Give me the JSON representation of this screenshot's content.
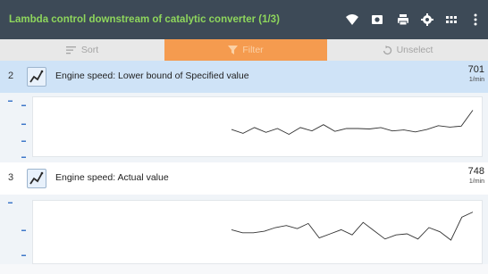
{
  "header": {
    "title": "Lambda control downstream of catalytic converter (1/3)",
    "icons": [
      "wifi-icon",
      "camera-icon",
      "print-icon",
      "settings-icon",
      "grid-icon",
      "more-icon"
    ]
  },
  "toolbar": {
    "sort_label": "Sort",
    "filter_label": "Filter",
    "unselect_label": "Unselect"
  },
  "colors": {
    "header_bg": "#3d4a57",
    "title_text": "#8ed65c",
    "filter_active": "#f59b4f",
    "selected_row": "#cfe3f7"
  },
  "rows": [
    {
      "index": "2",
      "label": "Engine speed: Lower bound of Specified value",
      "value": "701",
      "unit": "1/min",
      "selected": true,
      "icon": "graph-icon",
      "trend": [
        0.48,
        0.4,
        0.52,
        0.42,
        0.5,
        0.38,
        0.52,
        0.45,
        0.58,
        0.44,
        0.5,
        0.5,
        0.49,
        0.52,
        0.45,
        0.47,
        0.43,
        0.48,
        0.56,
        0.53,
        0.55,
        0.88
      ]
    },
    {
      "index": "3",
      "label": "Engine speed: Actual value",
      "value": "748",
      "unit": "1/min",
      "selected": false,
      "icon": "graph-icon",
      "trend": [
        0.58,
        0.52,
        0.52,
        0.55,
        0.62,
        0.66,
        0.6,
        0.7,
        0.42,
        0.5,
        0.58,
        0.48,
        0.72,
        0.56,
        0.4,
        0.48,
        0.5,
        0.4,
        0.62,
        0.54,
        0.38,
        0.82,
        0.92
      ]
    }
  ]
}
